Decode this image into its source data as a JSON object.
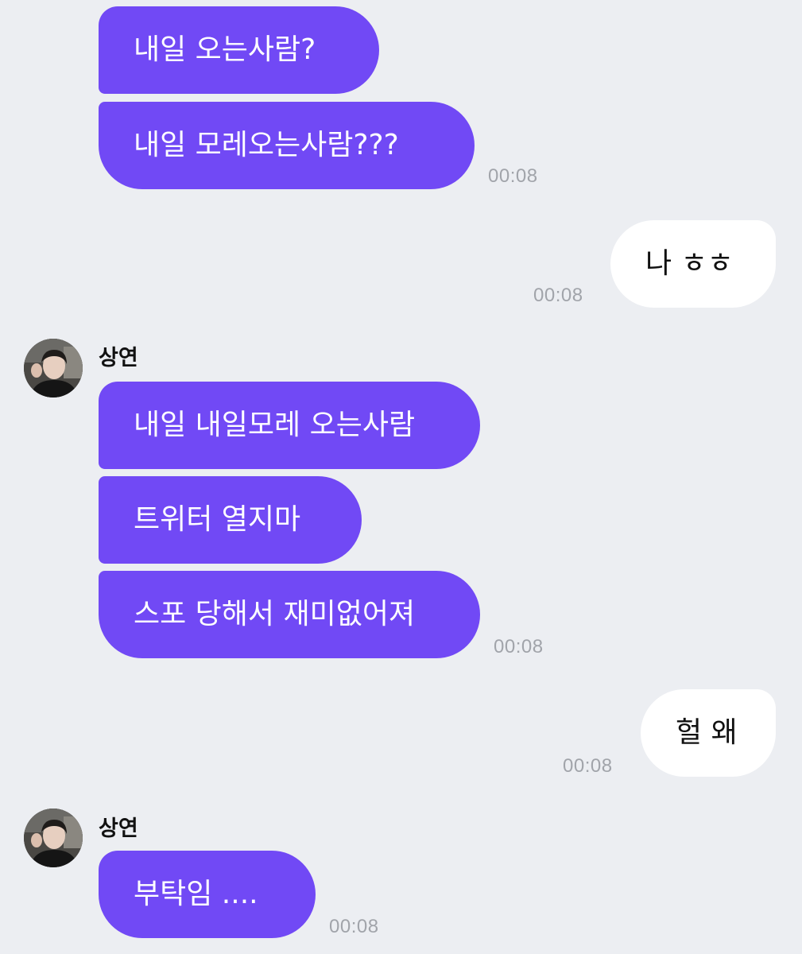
{
  "conversation": {
    "messages": [
      {
        "text": "내일 오는사람?"
      },
      {
        "text": "내일 모레오는사람???"
      },
      {
        "text": "나 ㅎㅎ"
      },
      {
        "text": "내일 내일모레 오는사람"
      },
      {
        "text": "트위터 열지마"
      },
      {
        "text": "스포 당해서 재미없어져"
      },
      {
        "text": "헐 왜"
      },
      {
        "text": "부탁임 ...."
      }
    ],
    "times": [
      "00:08",
      "00:08",
      "00:08",
      "00:08",
      "00:08"
    ],
    "senders": [
      "상연",
      "상연"
    ],
    "colors": {
      "incoming_bubble": "#7149f5",
      "outgoing_bubble": "#ffffff",
      "background": "#eceef2",
      "timestamp": "#a1a4aa"
    }
  }
}
